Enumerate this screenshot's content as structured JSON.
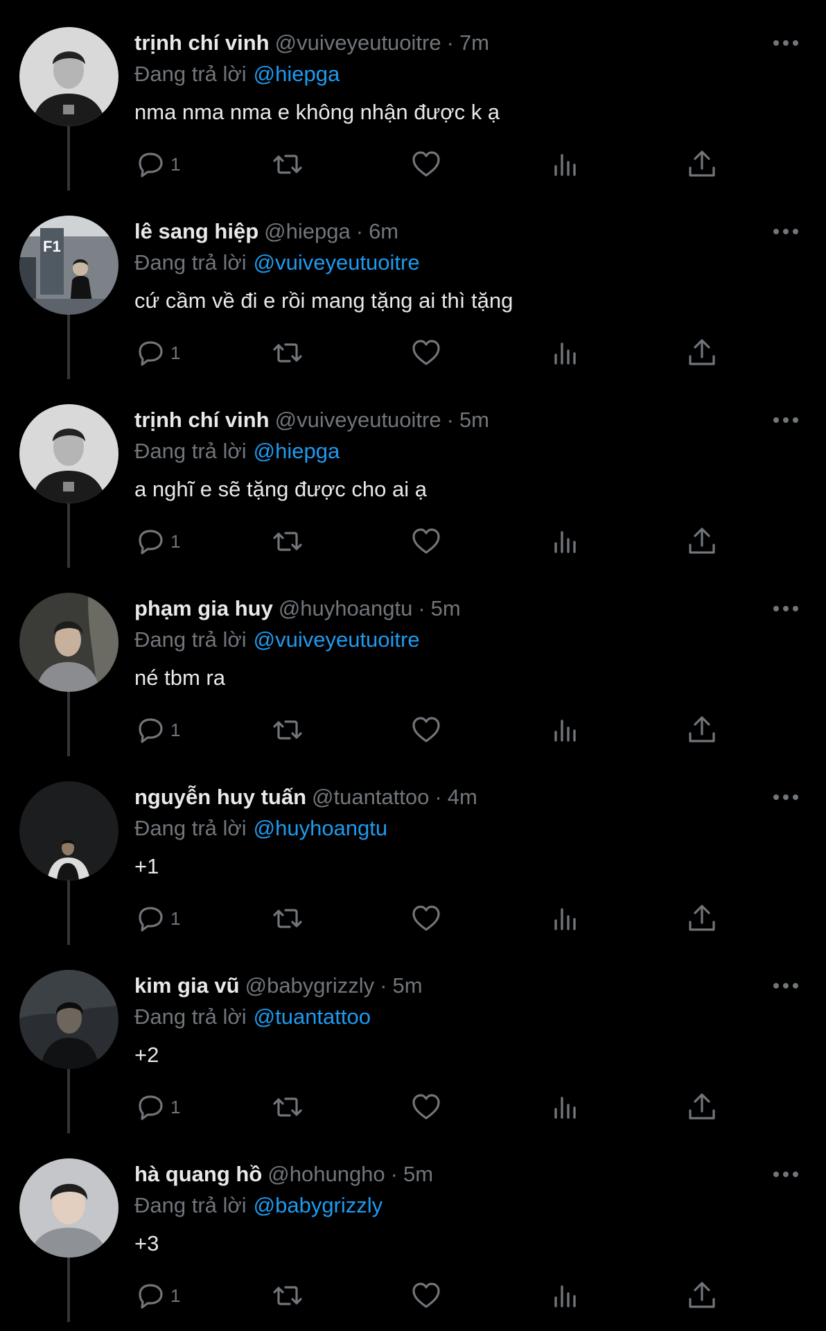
{
  "reply_prefix": "Đang trả lời",
  "colors": {
    "background": "#000000",
    "text": "#e7e9ea",
    "muted": "#71767b",
    "mention": "#1d9bf0",
    "thread_line": "#333639"
  },
  "icons": {
    "reply": "reply-icon",
    "retweet": "retweet-icon",
    "like": "heart-icon",
    "views": "analytics-icon",
    "share": "share-icon",
    "more": "more-icon"
  },
  "tweets": [
    {
      "name": "trịnh chí vinh",
      "handle": "@vuiveyeutuoitre",
      "time": "7m",
      "reply_to": "@hiepga",
      "text": "nma nma nma e không nhận được k ạ",
      "reply_count": "1"
    },
    {
      "name": "lê sang hiệp",
      "handle": "@hiepga",
      "time": "6m",
      "reply_to": "@vuiveyeutuoitre",
      "text": "cứ cầm về đi e rồi mang tặng ai thì tặng",
      "reply_count": "1"
    },
    {
      "name": "trịnh chí vinh",
      "handle": "@vuiveyeutuoitre",
      "time": "5m",
      "reply_to": "@hiepga",
      "text": "a nghĩ e sẽ tặng được cho ai ạ",
      "reply_count": "1"
    },
    {
      "name": "phạm gia huy",
      "handle": "@huyhoangtu",
      "time": "5m",
      "reply_to": "@vuiveyeutuoitre",
      "text": "né tbm ra",
      "reply_count": "1"
    },
    {
      "name": "nguyễn huy tuấn",
      "handle": "@tuantattoo",
      "time": "4m",
      "reply_to": "@huyhoangtu",
      "text": "+1",
      "reply_count": "1"
    },
    {
      "name": "kim gia vũ",
      "handle": "@babygrizzly",
      "time": "5m",
      "reply_to": "@tuantattoo",
      "text": "+2",
      "reply_count": "1"
    },
    {
      "name": "hà quang hồ",
      "handle": "@hohungho",
      "time": "5m",
      "reply_to": "@babygrizzly",
      "text": "+3",
      "reply_count": "1"
    }
  ]
}
